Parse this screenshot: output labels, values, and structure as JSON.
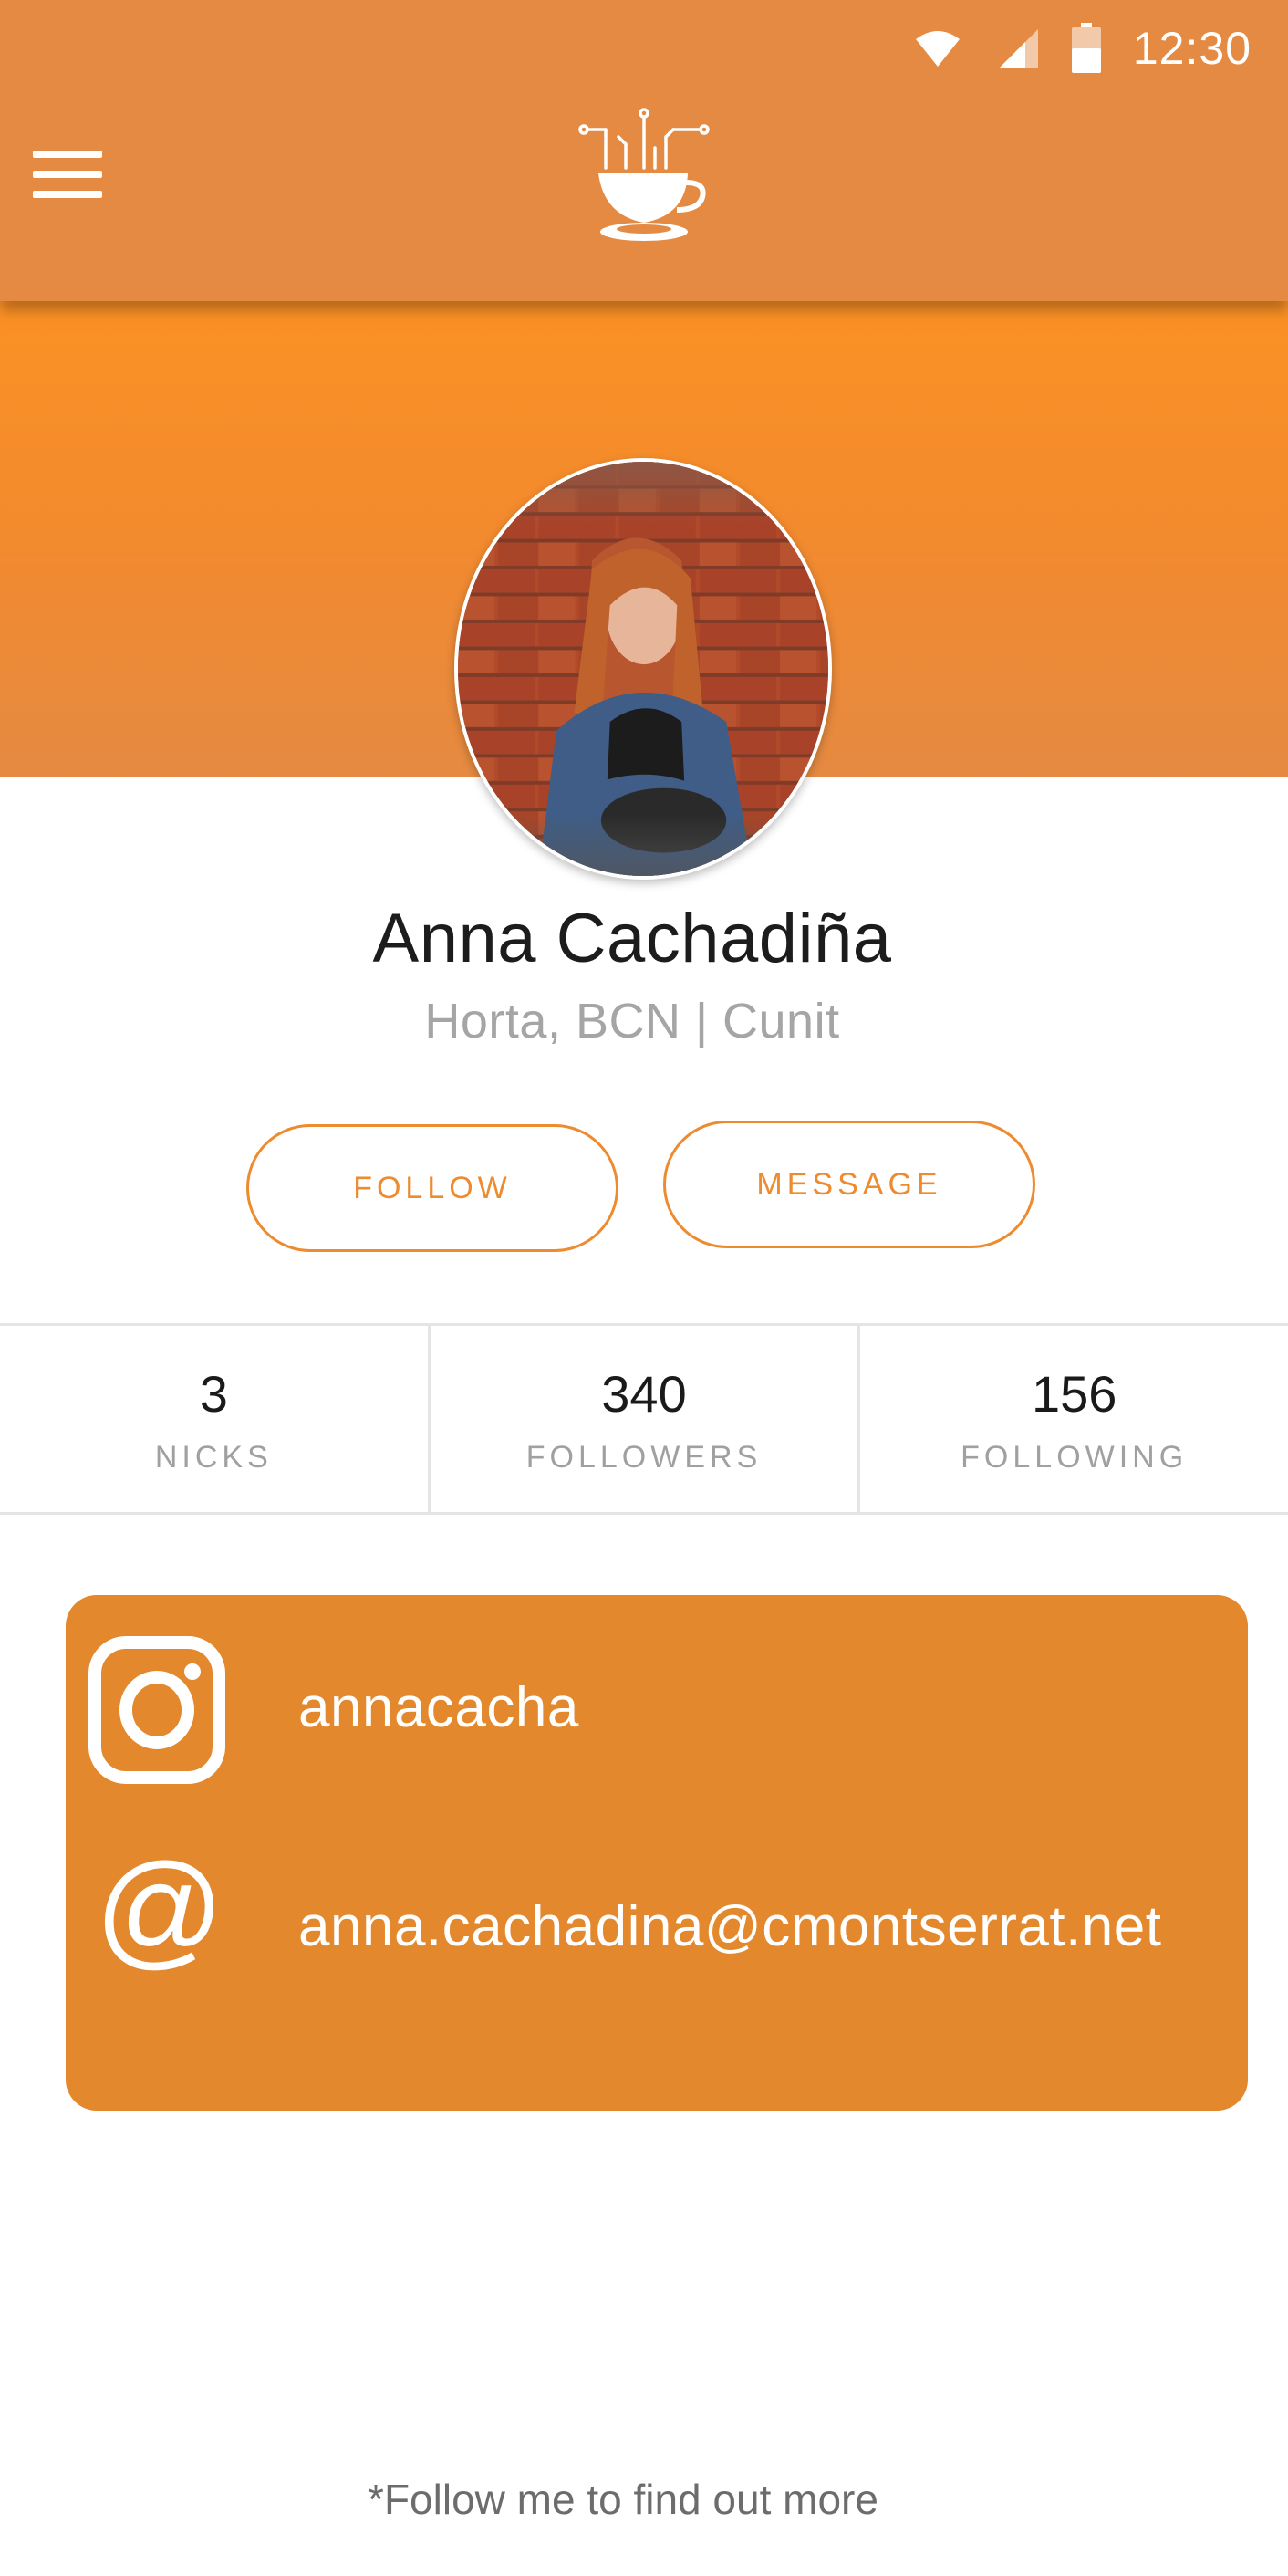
{
  "status_bar": {
    "time": "12:30"
  },
  "app_bar": {
    "menu_icon": "hamburger-menu-icon",
    "logo_icon": "coffee-cup-circuit-logo"
  },
  "colors": {
    "primary": "#e58a42",
    "accent": "#ee8b2e",
    "banner": "#fb9124",
    "card": "#e3882d"
  },
  "profile": {
    "name": "Anna Cachadiña",
    "location": "Horta, BCN | Cunit"
  },
  "actions": {
    "follow": "FOLLOW",
    "message": "MESSAGE"
  },
  "stats": [
    {
      "value": "3",
      "label": "NICKS"
    },
    {
      "value": "340",
      "label": "FOLLOWERS"
    },
    {
      "value": "156",
      "label": "FOLLOWING"
    }
  ],
  "contact": {
    "instagram": {
      "icon": "instagram-icon",
      "text": "annacacha"
    },
    "email": {
      "icon": "at-sign-icon",
      "text": "anna.cachadina@cmontserrat.net"
    }
  },
  "footer": {
    "note": "*Follow me to find out more"
  }
}
